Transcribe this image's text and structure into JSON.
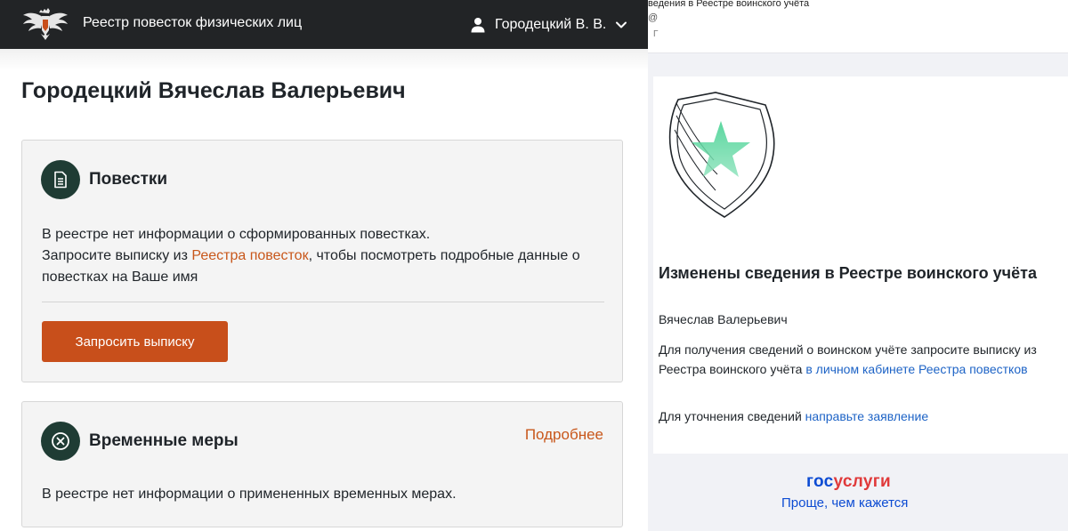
{
  "left_panel": {
    "header": {
      "app_title": "Реестр повесток физических лиц",
      "user_name": "Городецкий В. В."
    },
    "person_full_name": "Городецкий Вячеслав Валерьевич",
    "summons_card": {
      "title": "Повестки",
      "text_line1": "В реестре нет информации о сформированных повестках.",
      "text_before_link": "Запросите выписку из ",
      "link_text": "Реестра повесток",
      "text_after_link": ", чтобы посмотреть подробные данные о повестках на Ваше имя",
      "button_label": "Запросить выписку"
    },
    "measures_card": {
      "title": "Временные меры",
      "more_link": "Подробнее",
      "text": "В реестре нет информации о примененных временных мерах."
    }
  },
  "right_panel": {
    "email_header": {
      "subject": "ведения в Реестре воинского учёта",
      "at_sign": "@",
      "from_fragment": "Г"
    },
    "email": {
      "title": "Изменены сведения в Реестре воинского учёта",
      "greeting": "Вячеслав Валерьевич",
      "p1_text": "Для получения сведений о воинском учёте запросите выписку из Реестра воинского учёта ",
      "p1_link": "в личном кабинете Реестра повестков",
      "p2_text": "Для уточнения сведений ",
      "p2_link": "направьте заявление"
    },
    "footer": {
      "logo_part1": "гос",
      "logo_part2": "услуги",
      "slogan": "Проще, чем кажется"
    }
  },
  "colors": {
    "topbar": "#222426",
    "accent_orange": "#c84f1b",
    "icon_circle": "#1f3c34",
    "link_blue": "#1d63c6",
    "gosuslugi_blue": "#0d4cd3",
    "gosuslugi_red": "#e03a3a",
    "star_green": "#5fcf9f"
  },
  "icons": {
    "emblem": "double-headed-eagle-emblem",
    "user": "user-icon",
    "chevron": "chevron-down-icon",
    "document": "document-icon",
    "cancel": "close-circle-icon",
    "shield_star": "shield-star-illustration"
  }
}
